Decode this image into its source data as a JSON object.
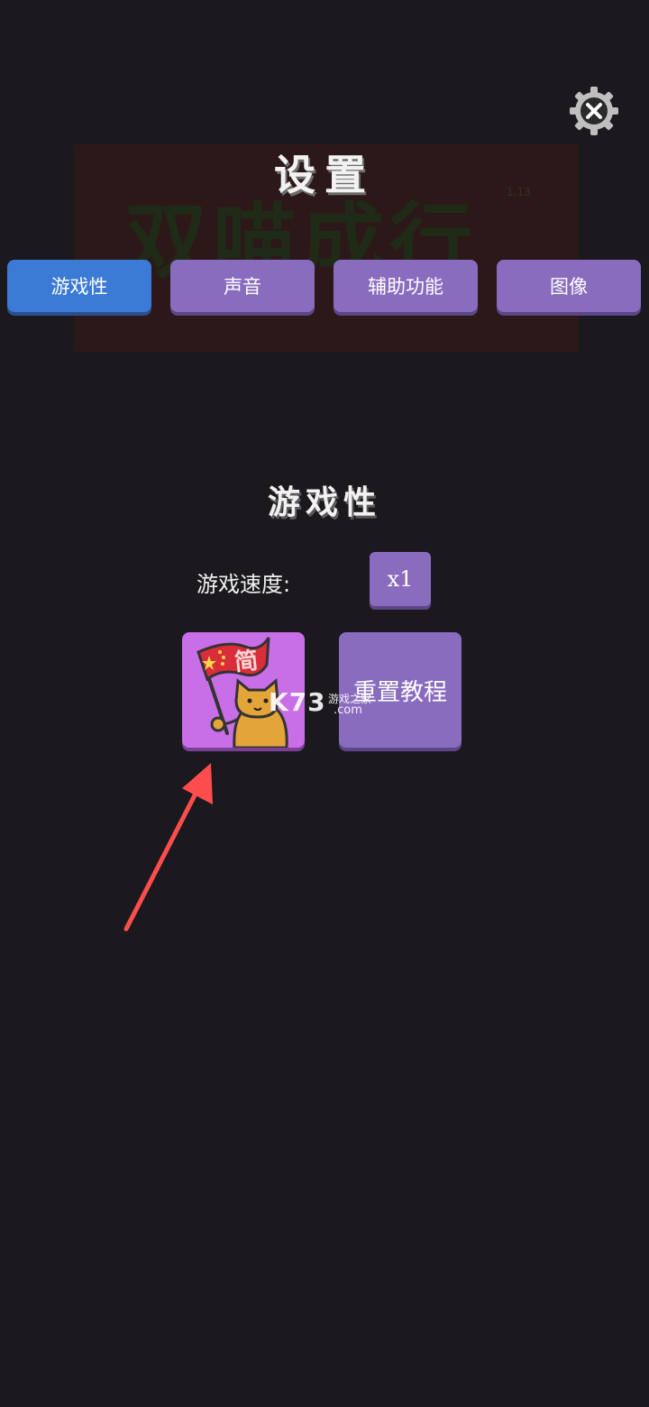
{
  "background_logo": {
    "text": "双喵成行",
    "version": "1.13"
  },
  "header": {
    "title": "设置"
  },
  "close_button": {
    "icon": "close-gear-icon"
  },
  "tabs": [
    {
      "label": "游戏性",
      "active": true
    },
    {
      "label": "声音",
      "active": false
    },
    {
      "label": "辅助功能",
      "active": false
    },
    {
      "label": "图像",
      "active": false
    }
  ],
  "gameplay": {
    "heading": "游戏性",
    "speed_label": "游戏速度:",
    "speed_value": "x1",
    "language_button": {
      "char": "简",
      "icon": "cat-with-china-flag-icon"
    },
    "reset_tutorial_label": "重置教程"
  },
  "watermark": {
    "brand": "K73",
    "cn": "游戏之家",
    "suffix": ".com"
  },
  "colors": {
    "background": "#1b191d",
    "tab_active": "#3b7ad5",
    "button_purple": "#8a6cbf",
    "language_button": "#c86ee6",
    "arrow": "#ff4d4d"
  }
}
